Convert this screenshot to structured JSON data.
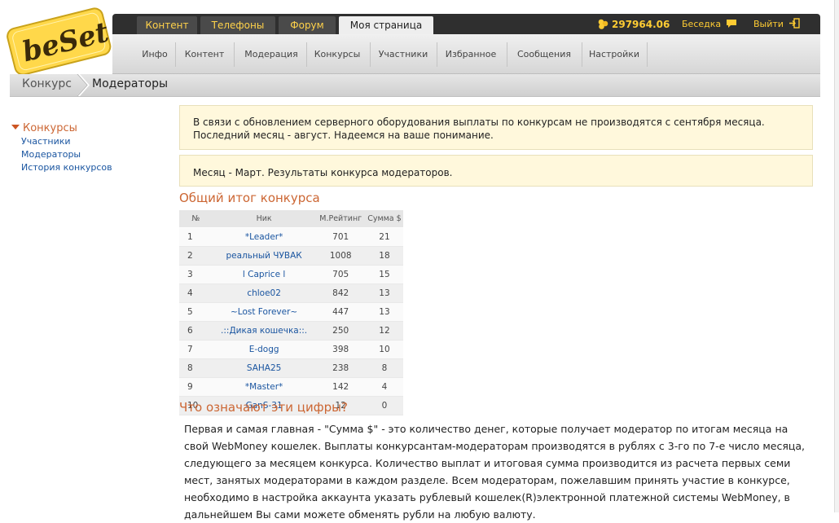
{
  "logo": {
    "text": "beSet",
    "alt": "beeSet"
  },
  "topnav": {
    "tabs": [
      {
        "label": "Контент",
        "active": false
      },
      {
        "label": "Телефоны",
        "active": false
      },
      {
        "label": "Форум",
        "active": false
      },
      {
        "label": "Моя страница",
        "active": true
      }
    ],
    "balance": "297964.06",
    "chat": "Беседка",
    "logout": "Выйти"
  },
  "subnav": [
    "Инфо",
    "Контент",
    "Модерация",
    "Конкурсы",
    "Участники",
    "Избранное",
    "Сообщения",
    "Настройки"
  ],
  "breadcrumb": {
    "parent": "Конкурс",
    "current": "Модераторы"
  },
  "sidebar": {
    "heading": "Конкурсы",
    "items": [
      "Участники",
      "Модераторы",
      "История конкурсов"
    ]
  },
  "notices": {
    "server": "В связи с обновлением серверного оборудования выплаты по конкурсам не производятся с сентября месяца. Последний месяц - август. Надеемся на ваше понимание.",
    "month": "Месяц - Март. Результаты конкурса модераторов."
  },
  "results": {
    "title": "Общий итог конкурса",
    "columns": [
      "№",
      "Ник",
      "М.Рейтинг",
      "Сумма $"
    ],
    "rows": [
      {
        "n": "1",
        "nick": "*Leader*",
        "rating": "701",
        "sum": "21"
      },
      {
        "n": "2",
        "nick": "реальный ЧУВАК",
        "rating": "1008",
        "sum": "18"
      },
      {
        "n": "3",
        "nick": "l Caprice l",
        "rating": "705",
        "sum": "15"
      },
      {
        "n": "4",
        "nick": "chloe02",
        "rating": "842",
        "sum": "13"
      },
      {
        "n": "5",
        "nick": "~Lost Forever~",
        "rating": "447",
        "sum": "13"
      },
      {
        "n": "6",
        "nick": ".::Дикая кошечка::.",
        "rating": "250",
        "sum": "12"
      },
      {
        "n": "7",
        "nick": "E-dogg",
        "rating": "398",
        "sum": "10"
      },
      {
        "n": "8",
        "nick": "SAHA25",
        "rating": "238",
        "sum": "8"
      },
      {
        "n": "9",
        "nick": "*Master*",
        "rating": "142",
        "sum": "4"
      },
      {
        "n": "10",
        "nick": "GanS-31",
        "rating": "12",
        "sum": "0"
      }
    ]
  },
  "explain": {
    "title": "Что означают эти цифры?",
    "text": "Первая и самая главная - \"Сумма $\" - это количество денег, которые получает модератор по итогам месяца на свой WebMoney кошелек. Выплаты конкурсантам-модераторам производятся в рублях с 3-го по 7-е число месяца, следующего за месяцем конкурса. Количество выплат и итоговая сумма производится из расчета первых семи мест, занятых модераторами в каждом разделе. Всем модераторам, пожелавшим принять участие в конкурсе, необходимо в настройка аккаунта указать рублевый кошелек(R)электронной платежной системы WebMoney, в дальнейшем Вы сами можете обменять рубли на любую валюту."
  },
  "colors": {
    "accent": "#cc6633",
    "link": "#1a55a0",
    "topbar": "#2f2f2f",
    "gold": "#ffcc33",
    "notice_bg": "#fff8dc"
  }
}
